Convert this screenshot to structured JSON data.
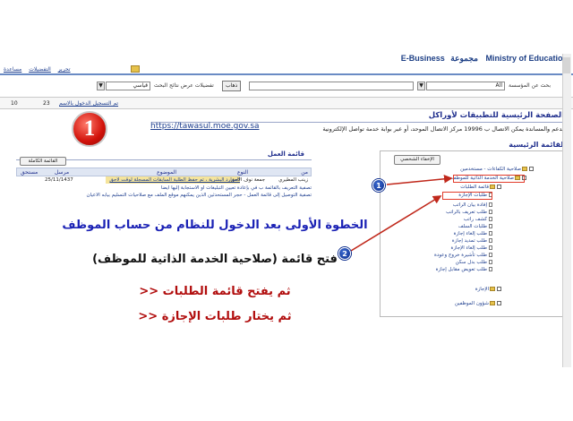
{
  "header": {
    "brand_org": "Ministry of Education",
    "brand_arabic": "مجموعة",
    "brand_ebiz": "E-Business",
    "top_links": [
      "تحرير",
      "التفضيلات",
      "مساعدة"
    ]
  },
  "search": {
    "scope_label": "بحث عن المؤسسة",
    "scope_value": "All",
    "go_button": "ذهاب",
    "prefs_label": "تفضيلات عرض نتائج البحث",
    "mode_value": "قياسي"
  },
  "info_row": {
    "count_left": "10",
    "count_mid": "23",
    "link_text": "تم التسجيل الدخول بالاسم"
  },
  "page": {
    "title": "الصفحة الرئيسية للتطبيقات لأوراكل",
    "description": "للدعم والمساندة يمكن الاتصال ب 19996 مركز الاتصال الموحد، أو عبر بوابة خدمة تواصل الإلكترونية",
    "url": "https://tawasul.moe.gov.sa"
  },
  "badge": {
    "text": "1"
  },
  "tasks": {
    "title": "قائمة العمل",
    "full_list_button": "القائمة الكاملة",
    "columns": [
      "من",
      "النوع",
      "الموضوع",
      "مرسل",
      "مستحق"
    ],
    "row_from": "زينب المطيري",
    "row_type": "جمعة نوف الاحق",
    "row_subject": "الموارد البشرية ، تم حفظ الطلبة السابقات المسجلة لوقت لاحق",
    "row_sent": "25/11/1437",
    "note1": "تصفية التعريف بالقائمة ب في بإعادة تعيين التبليغات أو الاستجابة إليها أيضا",
    "note2": "تصفية التوصيل إلى قائمة العمل - حجر المستحدثين الذين يمكنهم موقع الملف مع صلاحيات التسليم بيابه الأعيان"
  },
  "menu": {
    "title": "القائمة الرئيسية",
    "hide_button": "الإخفاء الشخصي",
    "items": [
      "صلاحية الكفاءات - مستخدمين",
      "صلاحية الخدمة الذاتية للموظف",
      "قائمة الطلبات",
      "طلبات الإجازة",
      "إفادة بيان الراتب",
      "طلب تعريف بالراتب",
      "كشف راتب",
      "طلبات السلف",
      "طلب إلغاء إجازة",
      "طلب تمديد إجازة",
      "طلب إلغاء الإجازة",
      "طلب تأشيرة خروج وعودة",
      "طلب بدل سكن",
      "طلب تعويض مقابل إجازة",
      "الإجازة",
      "شؤون الموظفين"
    ]
  },
  "markers": [
    "1",
    "2"
  ],
  "instructions": {
    "line1": "الخطوة الأولى بعد الدخول للنظام من حساب الموظف",
    "line2": "فتح قائمة (صلاحية الخدمة الذاتية للموظف)",
    "line3": ">> ثم يفتح قائمة الطلبات",
    "line4": ">> ثم يختار طلبات الإجازة"
  },
  "colors": {
    "brand_blue": "#1d3f85",
    "instruction_blue": "#1b22b5",
    "instruction_red": "#b10d0d",
    "arrow_red": "#c0281b",
    "highlight_yellow": "#f5e49b"
  }
}
